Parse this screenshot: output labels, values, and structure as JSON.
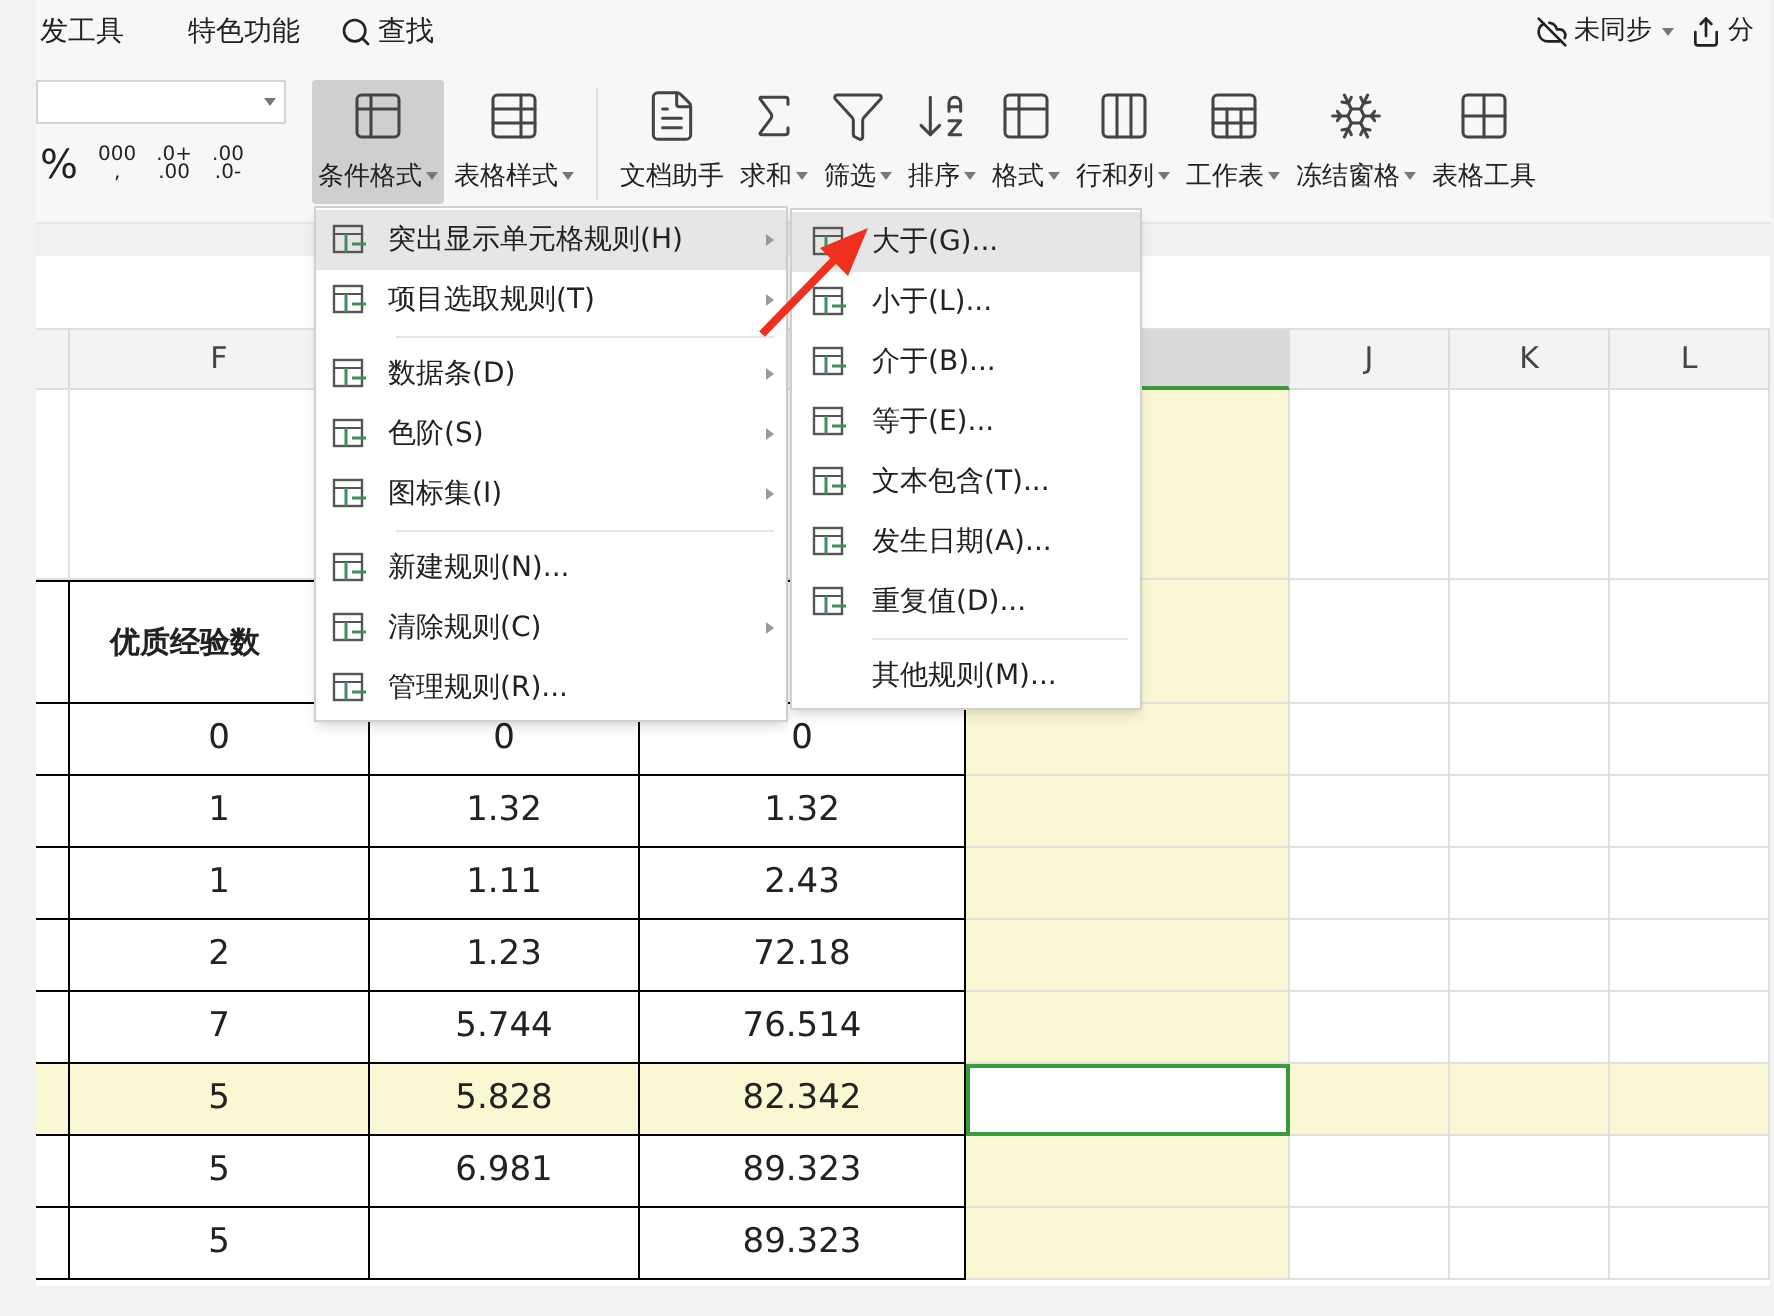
{
  "menu_tabs": [
    {
      "label": "发工具",
      "selected": false
    },
    {
      "label": "特色功能",
      "selected": false
    }
  ],
  "search": {
    "label": "查找"
  },
  "sync": {
    "label": "未同步"
  },
  "share": {
    "label": "分"
  },
  "number_formats": [
    "%",
    "000\n,",
    ".0+\n.00",
    ".00\n.0-"
  ],
  "ribbon_buttons": [
    {
      "label": "条件格式",
      "kind": "table",
      "pressed": true,
      "dropdown": true
    },
    {
      "label": "表格样式",
      "kind": "style",
      "pressed": false,
      "dropdown": true
    },
    {
      "label": "文档助手",
      "kind": "doc",
      "pressed": false,
      "dropdown": false
    },
    {
      "label": "求和",
      "kind": "sum",
      "pressed": false,
      "dropdown": true
    },
    {
      "label": "筛选",
      "kind": "filter",
      "pressed": false,
      "dropdown": true
    },
    {
      "label": "排序",
      "kind": "sort",
      "pressed": false,
      "dropdown": true
    },
    {
      "label": "格式",
      "kind": "table",
      "pressed": false,
      "dropdown": true
    },
    {
      "label": "行和列",
      "kind": "columns",
      "pressed": false,
      "dropdown": true
    },
    {
      "label": "工作表",
      "kind": "sheet",
      "pressed": false,
      "dropdown": true
    },
    {
      "label": "冻结窗格",
      "kind": "freeze",
      "pressed": false,
      "dropdown": true
    },
    {
      "label": "表格工具",
      "kind": "grid",
      "pressed": false,
      "dropdown": false
    }
  ],
  "columns": [
    {
      "label": "F",
      "selected": false
    },
    {
      "selected": true
    },
    {
      "label": "J",
      "selected": false
    },
    {
      "label": "K",
      "selected": false
    },
    {
      "label": "L",
      "selected": false
    }
  ],
  "table": {
    "header": "优质经验数",
    "rows": [
      {
        "cells": [
          "0",
          "0",
          "0"
        ],
        "highlighted": false,
        "active": false
      },
      {
        "cells": [
          "1",
          "1.32",
          "1.32"
        ],
        "highlighted": false,
        "active": false
      },
      {
        "cells": [
          "1",
          "1.11",
          "2.43"
        ],
        "highlighted": false,
        "active": false
      },
      {
        "cells": [
          "2",
          "1.23",
          "72.18"
        ],
        "highlighted": false,
        "active": false
      },
      {
        "cells": [
          "7",
          "5.744",
          "76.514"
        ],
        "highlighted": false,
        "active": false
      },
      {
        "cells": [
          "5",
          "5.828",
          "82.342"
        ],
        "highlighted": true,
        "active": true
      },
      {
        "cells": [
          "5",
          "6.981",
          "89.323"
        ],
        "highlighted": false,
        "active": false
      },
      {
        "cells": [
          "5",
          "",
          "89.323"
        ],
        "highlighted": false,
        "active": false
      }
    ]
  },
  "context_menu": {
    "items": [
      {
        "label": "突出显示单元格规则(H)",
        "submenu": true,
        "selected": true,
        "separator_after": false
      },
      {
        "label": "项目选取规则(T)",
        "submenu": true,
        "selected": false,
        "separator_after": true
      },
      {
        "label": "数据条(D)",
        "submenu": true,
        "selected": false,
        "separator_after": false
      },
      {
        "label": "色阶(S)",
        "submenu": true,
        "selected": false,
        "separator_after": false
      },
      {
        "label": "图标集(I)",
        "submenu": true,
        "selected": false,
        "separator_after": true
      },
      {
        "label": "新建规则(N)...",
        "submenu": false,
        "selected": false,
        "separator_after": false
      },
      {
        "label": "清除规则(C)",
        "submenu": true,
        "selected": false,
        "separator_after": false
      },
      {
        "label": "管理规则(R)...",
        "submenu": false,
        "selected": false,
        "separator_after": false
      }
    ]
  },
  "submenu": {
    "items": [
      {
        "label": "大于(G)...",
        "icon": true,
        "selected": true,
        "separator_after": false
      },
      {
        "label": "小于(L)...",
        "icon": true,
        "selected": false,
        "separator_after": false
      },
      {
        "label": "介于(B)...",
        "icon": true,
        "selected": false,
        "separator_after": false
      },
      {
        "label": "等于(E)...",
        "icon": true,
        "selected": false,
        "separator_after": false
      },
      {
        "label": "文本包含(T)...",
        "icon": true,
        "selected": false,
        "separator_after": false
      },
      {
        "label": "发生日期(A)...",
        "icon": true,
        "selected": false,
        "separator_after": false
      },
      {
        "label": "重复值(D)...",
        "icon": true,
        "selected": false,
        "separator_after": true
      },
      {
        "label": "其他规则(M)...",
        "icon": false,
        "selected": false,
        "separator_after": false
      }
    ]
  }
}
